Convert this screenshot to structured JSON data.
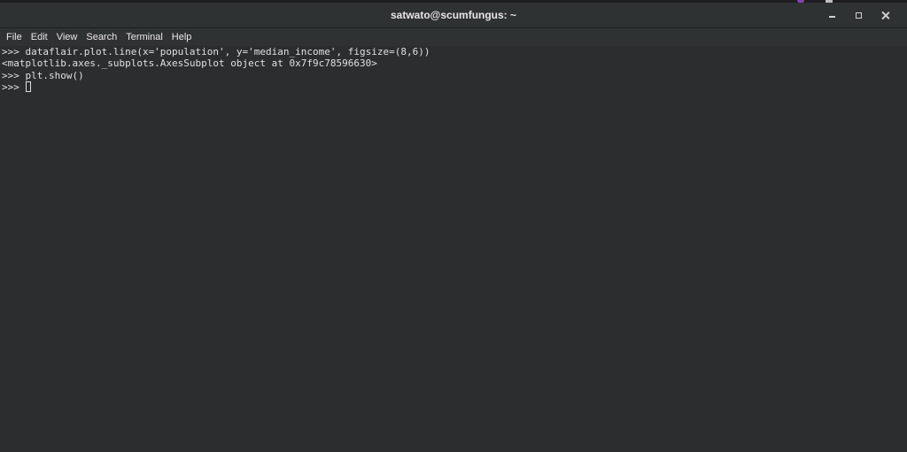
{
  "window": {
    "title": "satwato@scumfungus: ~"
  },
  "menu": {
    "items": [
      "File",
      "Edit",
      "View",
      "Search",
      "Terminal",
      "Help"
    ]
  },
  "terminal": {
    "lines": [
      ">>> dataflair.plot.line(x='population', y='median_income', figsize=(8,6))",
      "<matplotlib.axes._subplots.AxesSubplot object at 0x7f9c78596630>",
      ">>> plt.show()",
      ">>> "
    ]
  },
  "icons": {
    "minimize": "minimize-icon",
    "maximize": "maximize-icon",
    "close": "close-icon",
    "cursor": "cursor-block"
  },
  "colors": {
    "background": "#2b2d2e",
    "titlebar": "#2f3233",
    "text": "#e0e0e0"
  }
}
